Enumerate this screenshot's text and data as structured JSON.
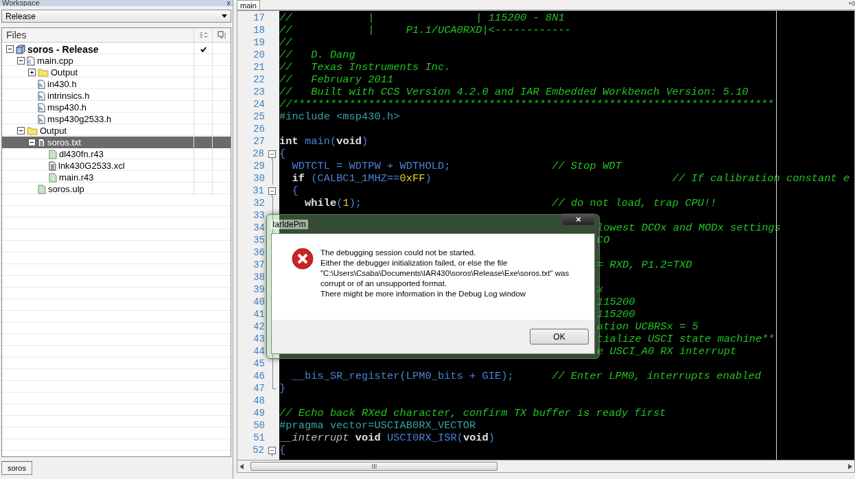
{
  "workspace": {
    "title": "Workspace",
    "close": "x",
    "configuration": "Release",
    "files_header": "Files",
    "tree": [
      {
        "label": "soros - Release",
        "kind": "project",
        "expanded": true,
        "checked": true,
        "selected": false,
        "children": [
          {
            "label": "main.cpp",
            "kind": "cpp",
            "expanded": true,
            "selected": false,
            "children": [
              {
                "label": "Output",
                "kind": "folder",
                "expanded": false,
                "selected": false
              },
              {
                "label": "in430.h",
                "kind": "header",
                "selected": false
              },
              {
                "label": "intrinsics.h",
                "kind": "header",
                "selected": false
              },
              {
                "label": "msp430.h",
                "kind": "header",
                "selected": false
              },
              {
                "label": "msp430g2533.h",
                "kind": "header",
                "selected": false
              }
            ]
          },
          {
            "label": "Output",
            "kind": "folder",
            "expanded": true,
            "selected": false,
            "children": [
              {
                "label": "soros.txt",
                "kind": "text",
                "expanded": true,
                "selected": true,
                "children": [
                  {
                    "label": "dl430fn.r43",
                    "kind": "object",
                    "selected": false
                  },
                  {
                    "label": "lnk430G2533.xcl",
                    "kind": "text",
                    "selected": false
                  },
                  {
                    "label": "main.r43",
                    "kind": "object",
                    "selected": false
                  }
                ]
              },
              {
                "label": "soros.ulp",
                "kind": "object",
                "selected": false
              }
            ]
          }
        ]
      }
    ],
    "tab": "soros"
  },
  "editor": {
    "tab": "main",
    "corner": "+0",
    "lines": [
      {
        "num": "17",
        "parts": [
          {
            "kind": "comment",
            "text": "//            |                | 115200 - 8N1"
          }
        ]
      },
      {
        "num": "18",
        "parts": [
          {
            "kind": "comment",
            "text": "//            |     P1.1/UCA0RXD|<------------"
          }
        ]
      },
      {
        "num": "19",
        "parts": [
          {
            "kind": "comment",
            "text": "//"
          }
        ]
      },
      {
        "num": "20",
        "parts": [
          {
            "kind": "comment",
            "text": "//   D. Dang"
          }
        ]
      },
      {
        "num": "21",
        "parts": [
          {
            "kind": "comment",
            "text": "//   Texas Instruments Inc."
          }
        ]
      },
      {
        "num": "22",
        "parts": [
          {
            "kind": "comment",
            "text": "//   February 2011"
          }
        ]
      },
      {
        "num": "23",
        "parts": [
          {
            "kind": "comment",
            "text": "//   Built with CCS Version 4.2.0 and IAR Embedded Workbench Version: 5.10"
          }
        ]
      },
      {
        "num": "24",
        "parts": [
          {
            "kind": "comment",
            "text": "//****************************************************************************"
          }
        ]
      },
      {
        "num": "25",
        "parts": [
          {
            "kind": "preproc",
            "text": "#include <msp430.h>"
          }
        ]
      },
      {
        "num": "26"
      },
      {
        "num": "27",
        "parts": [
          {
            "kind": "keyword",
            "text": "int "
          },
          {
            "kind": "ident",
            "text": "main"
          },
          {
            "kind": "plain",
            "text": "("
          },
          {
            "kind": "keyword",
            "text": "void"
          },
          {
            "kind": "plain",
            "text": ")"
          }
        ]
      },
      {
        "num": "28",
        "kind": "fold-start",
        "parts": [
          {
            "kind": "plain",
            "text": "{"
          }
        ]
      },
      {
        "num": "29",
        "kind": "fold-line",
        "parts": [
          {
            "kind": "ident",
            "text": "  WDTCTL = WDTPW + WDTHOLD;                "
          },
          {
            "kind": "comment",
            "text": "// Stop WDT"
          }
        ]
      },
      {
        "num": "30",
        "kind": "fold-line",
        "parts": [
          {
            "kind": "keyword",
            "text": "  if"
          },
          {
            "kind": "ident",
            "text": " (CALBC1_1MHZ=="
          },
          {
            "kind": "number",
            "text": "0xFF"
          },
          {
            "kind": "plain",
            "text": ")                                      "
          },
          {
            "kind": "comment",
            "text": "// If calibration constant e"
          }
        ]
      },
      {
        "num": "31",
        "kind": "fold-start",
        "parts": [
          {
            "kind": "plain",
            "text": "  {"
          }
        ]
      },
      {
        "num": "32",
        "kind": "fold-line",
        "parts": [
          {
            "kind": "keyword",
            "text": "    while"
          },
          {
            "kind": "plain",
            "text": "("
          },
          {
            "kind": "number",
            "text": "1"
          },
          {
            "kind": "plain",
            "text": ");                              "
          },
          {
            "kind": "comment",
            "text": "// do not load, trap CPU!!"
          }
        ]
      },
      {
        "num": "33",
        "kind": "fold-line"
      },
      {
        "num": "34",
        "kind": "fold-line",
        "covered": true,
        "parts": [
          {
            "kind": "comment",
            "text": "lowest DCOx and MODx settings"
          }
        ]
      },
      {
        "num": "35",
        "kind": "fold-line",
        "covered": true,
        "parts": [
          {
            "kind": "comment",
            "text": "CO"
          }
        ]
      },
      {
        "num": "36",
        "kind": "fold-line"
      },
      {
        "num": "37",
        "kind": "fold-line",
        "covered": true,
        "parts": [
          {
            "kind": "comment",
            "text": "= RXD, P1.2=TXD"
          }
        ]
      },
      {
        "num": "38",
        "kind": "fold-line"
      },
      {
        "num": "39",
        "kind": "fold-line",
        "covered": true,
        "parts": [
          {
            "kind": "comment",
            "text": "x"
          }
        ]
      },
      {
        "num": "40",
        "kind": "fold-line",
        "covered": true,
        "parts": [
          {
            "kind": "comment",
            "text": "115200"
          }
        ]
      },
      {
        "num": "41",
        "kind": "fold-line",
        "covered": true,
        "parts": [
          {
            "kind": "comment",
            "text": "115200"
          }
        ]
      },
      {
        "num": "42",
        "kind": "fold-line",
        "covered": true,
        "parts": [
          {
            "kind": "comment",
            "text": "ation UCBRSx = 5"
          }
        ]
      },
      {
        "num": "43",
        "kind": "fold-line",
        "covered": true,
        "parts": [
          {
            "kind": "comment",
            "text": "tialize USCI state machine**"
          }
        ]
      },
      {
        "num": "44",
        "kind": "fold-line",
        "covered": true,
        "parts": [
          {
            "kind": "comment",
            "text": "e USCI_A0 RX interrupt"
          }
        ]
      },
      {
        "num": "45",
        "kind": "fold-line"
      },
      {
        "num": "46",
        "kind": "fold-line",
        "parts": [
          {
            "kind": "ident",
            "text": "  __bis_SR_register(LPM0_bits + GIE);      "
          },
          {
            "kind": "comment",
            "text": "// Enter LPM0, interrupts enabled"
          }
        ]
      },
      {
        "num": "47",
        "kind": "fold-end",
        "parts": [
          {
            "kind": "plain",
            "text": "}"
          }
        ]
      },
      {
        "num": "48"
      },
      {
        "num": "49",
        "parts": [
          {
            "kind": "comment",
            "text": "// Echo back RXed character, confirm TX buffer is ready first"
          }
        ]
      },
      {
        "num": "50",
        "parts": [
          {
            "kind": "preproc",
            "text": "#pragma vector=USCIAB0RX_VECTOR"
          }
        ]
      },
      {
        "num": "51",
        "parts": [
          {
            "kind": "special",
            "text": "__interrupt "
          },
          {
            "kind": "keyword",
            "text": "void "
          },
          {
            "kind": "ident",
            "text": "USCI0RX_ISR"
          },
          {
            "kind": "plain",
            "text": "("
          },
          {
            "kind": "keyword",
            "text": "void"
          },
          {
            "kind": "plain",
            "text": ")"
          }
        ]
      },
      {
        "num": "52",
        "kind": "fold-start",
        "parts": [
          {
            "kind": "plain",
            "text": "{"
          }
        ]
      }
    ]
  },
  "dialog": {
    "title": "IarIdePm",
    "close": "×",
    "kind": "error",
    "message": [
      "The debugging session could not be started.",
      "Either the debugger initialization failed, or else the file",
      "\"C:\\Users\\Csaba\\Documents\\IAR430\\soros\\Release\\Exe\\soros.txt\" was",
      "corrupt or of an unsupported format.",
      "There might be more information in the Debug Log window"
    ],
    "button": "OK"
  }
}
